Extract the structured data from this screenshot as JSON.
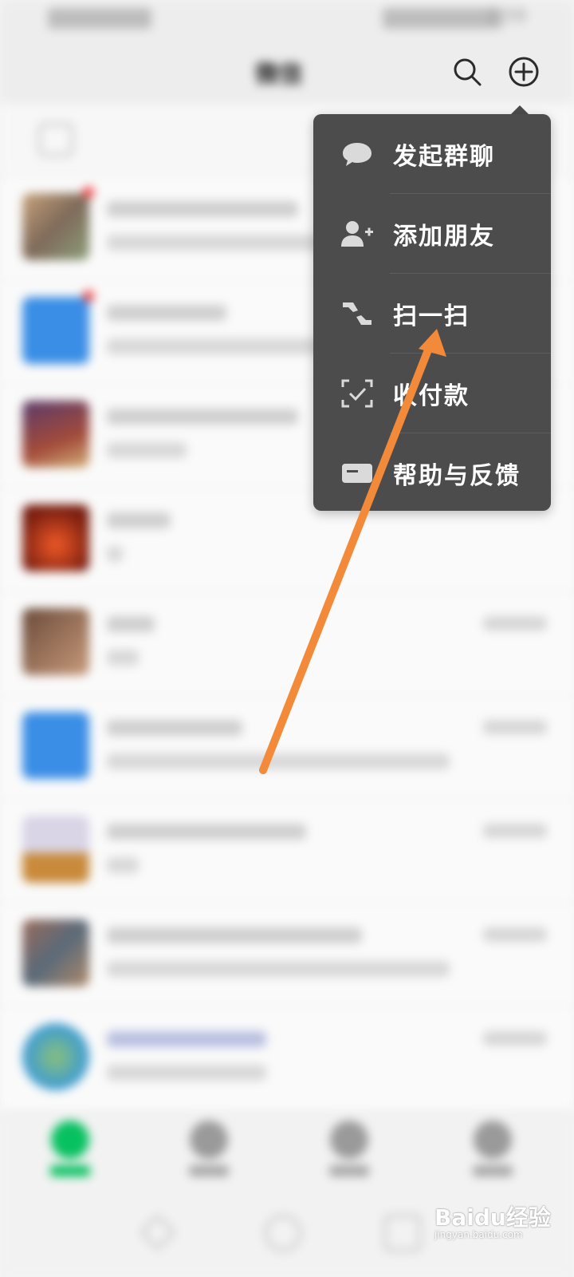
{
  "status_bar": {
    "time": "2:59"
  },
  "header": {
    "title": "微信"
  },
  "menu": {
    "items": [
      {
        "label": "发起群聊",
        "icon": "chat-bubble-icon"
      },
      {
        "label": "添加朋友",
        "icon": "add-friend-icon"
      },
      {
        "label": "扫一扫",
        "icon": "scan-icon"
      },
      {
        "label": "收付款",
        "icon": "payment-icon"
      },
      {
        "label": "帮助与反馈",
        "icon": "help-feedback-icon"
      }
    ]
  },
  "watermark": {
    "text": "Baidu经验",
    "url": "jingyan.baidu.com"
  },
  "colors": {
    "menu_background": "#4c4c4c",
    "arrow": "#f28a3a",
    "accent": "#07c160"
  }
}
